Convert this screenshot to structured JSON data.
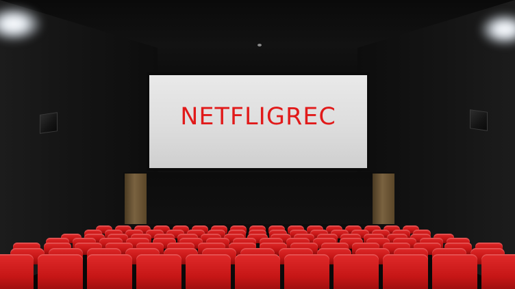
{
  "screen": {
    "title": "NETFLIGREC"
  },
  "colors": {
    "title": "#e11a1a",
    "seat": "#d11d1d",
    "screen": "#e3e3e3"
  },
  "scene": {
    "seat_rows": 7
  }
}
